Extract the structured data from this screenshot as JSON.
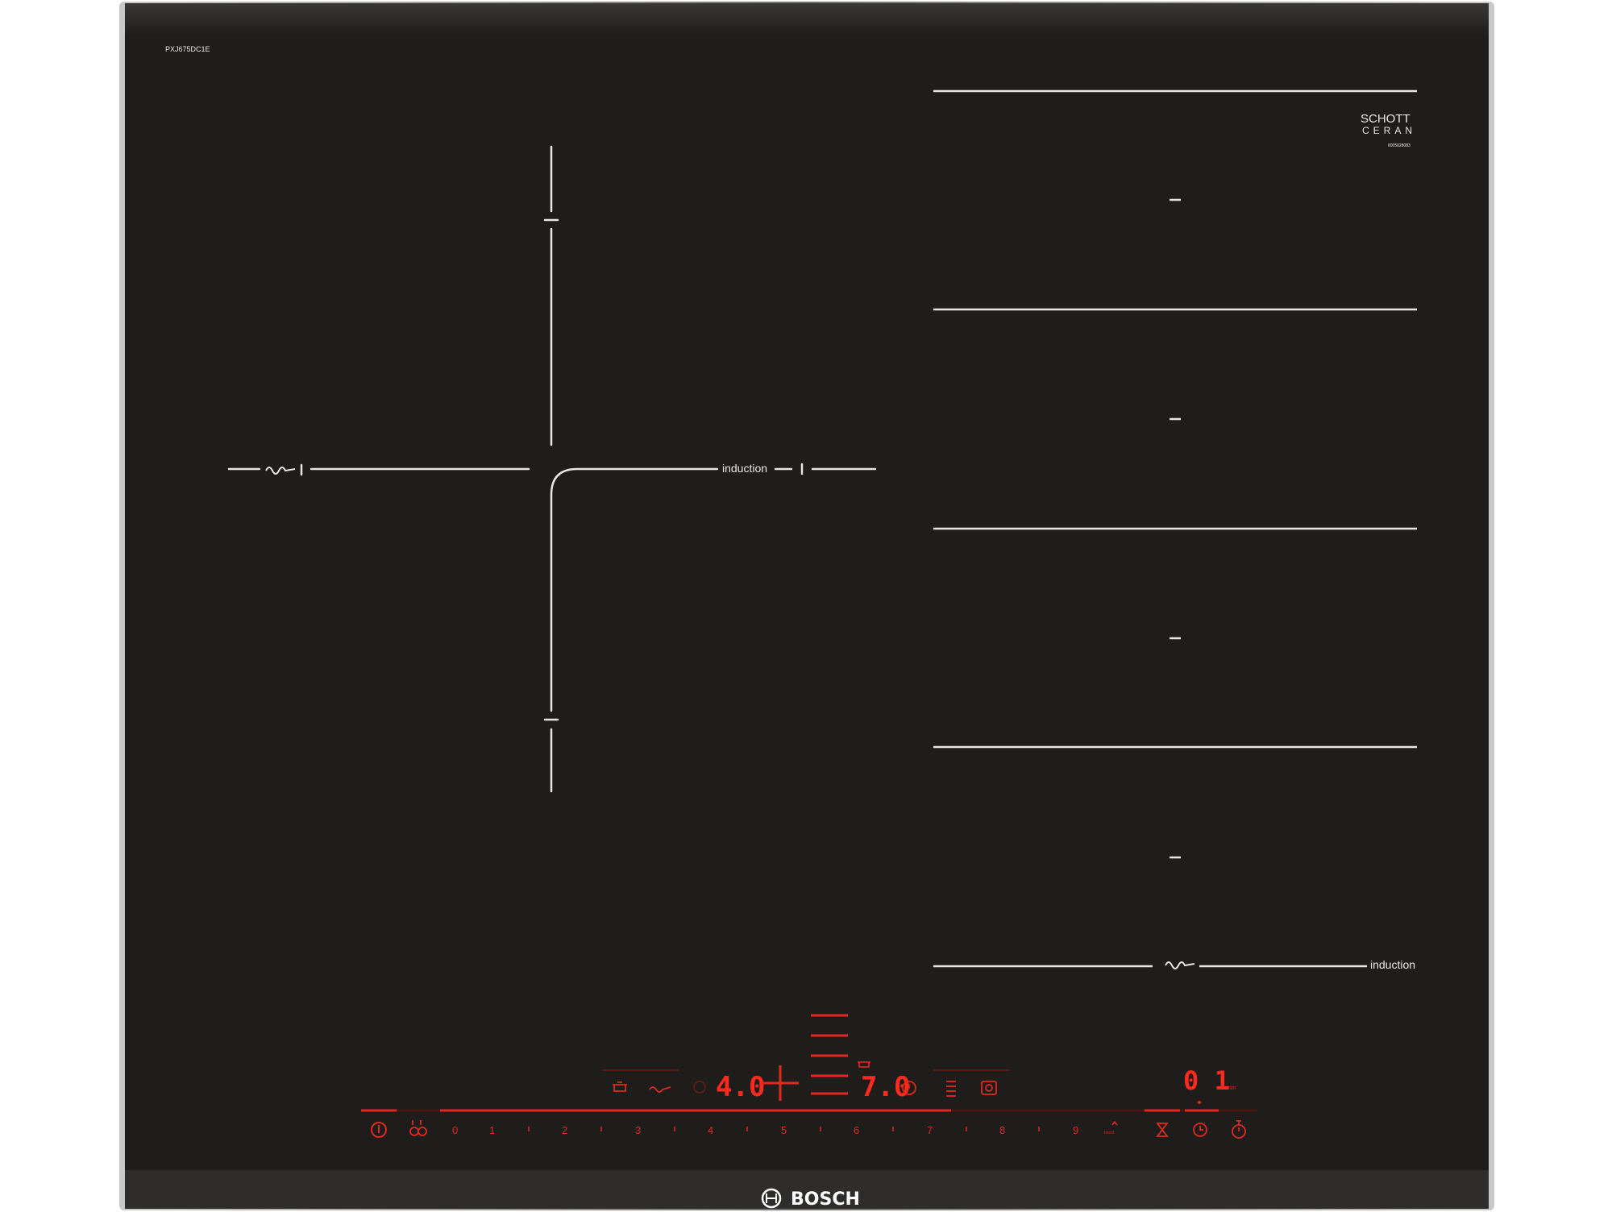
{
  "model_code": "PXJ675DC1E",
  "glass_logo": {
    "line1": "SCHOTT",
    "line2": "CERAN",
    "reg": "®",
    "serial": "8005028083"
  },
  "zone_labels": {
    "left_induction": "induction",
    "right_induction": "induction"
  },
  "display": {
    "left_power": "4.0",
    "right_power": "7.0",
    "timer": "0 1",
    "timer_unit": "min"
  },
  "power_scale": [
    "0",
    "1",
    "2",
    "3",
    "4",
    "5",
    "6",
    "7",
    "8",
    "9"
  ],
  "boost_label": "boost",
  "brand": {
    "name": "BOSCH"
  },
  "colors": {
    "glass": "#1f1d1c",
    "frame": "#9a9a9a",
    "lines": "#e6e6e6",
    "display": "#e0281e",
    "bezel": "#2b2a29"
  },
  "icons": {
    "power": "power-icon",
    "child_lock": "child-lock-icon",
    "pot_left": "cooking-pot-icon",
    "pan_left": "frying-pan-icon",
    "cross": "flexzone-cross-icon",
    "bars": "zone-level-bars-icon",
    "pot_right": "cooking-pot-icon",
    "timer_left": "timer-icon",
    "list": "menu-list-icon",
    "move": "move-mode-icon",
    "egg_timer": "egg-timer-icon",
    "clock": "clock-icon",
    "stopwatch": "stopwatch-icon"
  }
}
